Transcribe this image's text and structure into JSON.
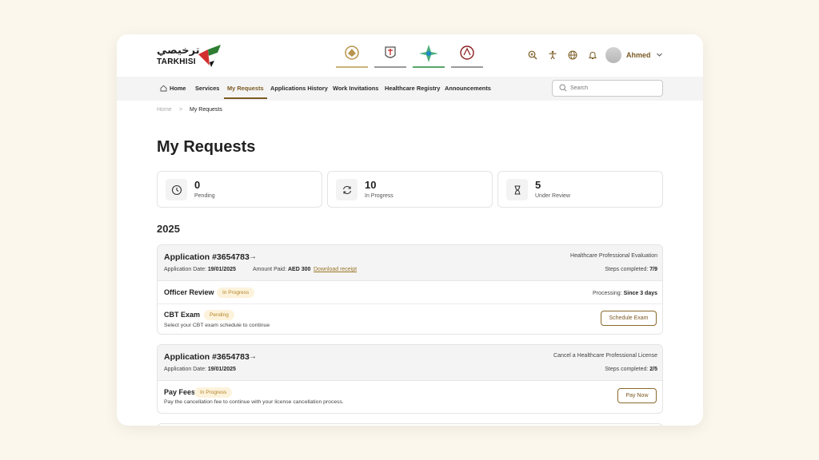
{
  "brand": {
    "name_ar": "ترخيصي",
    "name_en": "TARKHISI"
  },
  "header": {
    "user_name": "Ahmed"
  },
  "nav": {
    "items": [
      {
        "label": "Home"
      },
      {
        "label": "Services"
      },
      {
        "label": "My Requests"
      },
      {
        "label": "Applications History"
      },
      {
        "label": "Work Invitations"
      },
      {
        "label": "Healthcare Registry"
      },
      {
        "label": "Announcements"
      }
    ],
    "active": "My Requests",
    "search_placeholder": "Search"
  },
  "breadcrumb": {
    "home": "Home",
    "separator": ">",
    "current": "My Requests"
  },
  "page": {
    "title": "My Requests",
    "year": "2025"
  },
  "stats": [
    {
      "value": "0",
      "label": "Pending",
      "icon": "clock-icon"
    },
    {
      "value": "10",
      "label": "In Progress",
      "icon": "refresh-icon"
    },
    {
      "value": "5",
      "label": "Under Review",
      "icon": "hourglass-icon"
    }
  ],
  "applications": [
    {
      "title": "Application #3654783",
      "service": "Healthcare Professional Evaluation",
      "date_label": "Application Date:",
      "date": "19/01/2025",
      "amount_label": "Amount Paid:",
      "amount": "AED 300",
      "receipt_link": "Download receipt",
      "steps_label": "Steps completed:",
      "steps": "7/9",
      "stages": [
        {
          "title": "Officer Review",
          "status": "In Progress",
          "processing_label": "Processing:",
          "processing": "Since 3 days"
        },
        {
          "title": "CBT Exam",
          "status": "Pending",
          "description": "Select your CBT exam schedule to continue",
          "action": "Schedule Exam"
        }
      ]
    },
    {
      "title": "Application #3654783",
      "service": "Cancel a Healthcare Professional License",
      "date_label": "Application Date:",
      "date": "19/01/2025",
      "steps_label": "Steps completed:",
      "steps": "2/5",
      "stages": [
        {
          "title": "Pay Fees",
          "status": "In Progress",
          "description": "Pay the cancellation fee to continue with your license cancellation process.",
          "action": "Pay Now"
        }
      ]
    }
  ],
  "colors": {
    "accent": "#7a5a22",
    "badge_bg": "#fdf3dc",
    "badge_text": "#b4842a",
    "page_bg": "#fbf7ec"
  }
}
